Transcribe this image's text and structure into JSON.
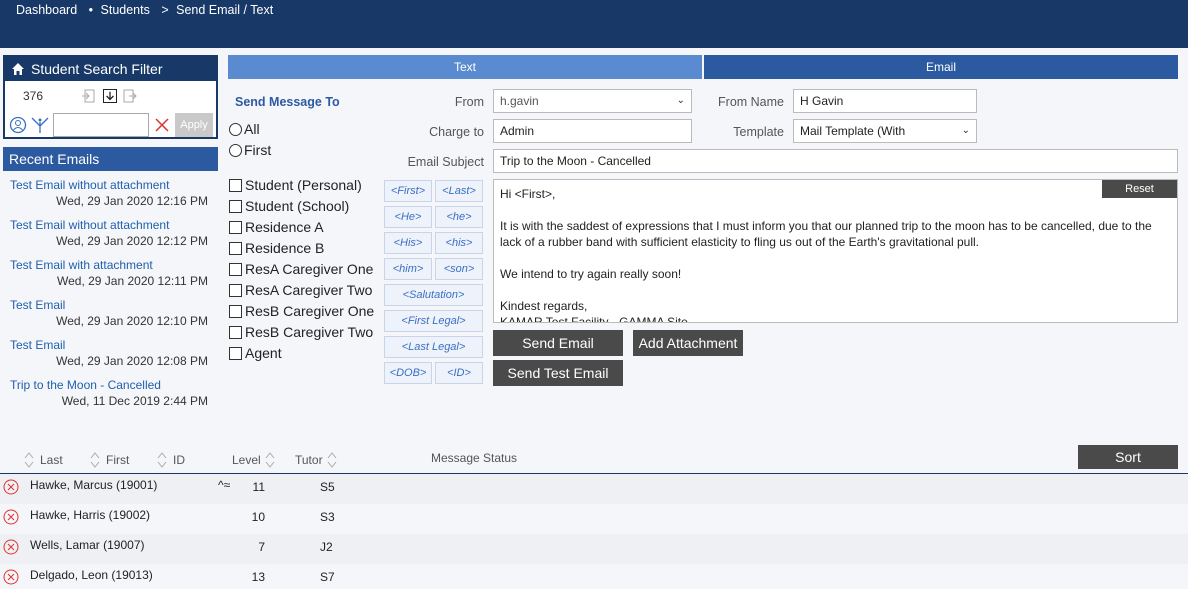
{
  "breadcrumb": {
    "item1": "Dashboard",
    "sep1": "•",
    "item2": "Students",
    "sep2": ">",
    "item3": "Send Email / Text"
  },
  "filter": {
    "title": "Student Search Filter",
    "count": "376",
    "input_value": "",
    "apply_label": "Apply"
  },
  "recent": {
    "title": "Recent Emails",
    "items": [
      {
        "title": "Test Email without attachment",
        "date": "Wed, 29 Jan 2020 12:16 PM"
      },
      {
        "title": "Test Email without attachment",
        "date": "Wed, 29 Jan 2020 12:12 PM"
      },
      {
        "title": "Test Email with attachment",
        "date": "Wed, 29 Jan 2020 12:11 PM"
      },
      {
        "title": "Test Email",
        "date": "Wed, 29 Jan 2020 12:10 PM"
      },
      {
        "title": "Test Email",
        "date": "Wed, 29 Jan 2020 12:08 PM"
      },
      {
        "title": "Trip to the Moon - Cancelled",
        "date": "Wed, 11 Dec 2019 2:44 PM"
      }
    ]
  },
  "tabs": {
    "text": "Text",
    "email": "Email"
  },
  "send_to": {
    "title": "Send Message To",
    "radios": [
      "All",
      "First"
    ],
    "checks": [
      "Student (Personal)",
      "Student (School)",
      "Residence A",
      "Residence B",
      "ResA Caregiver One",
      "ResA Caregiver Two",
      "ResB Caregiver One",
      "ResB Caregiver Two",
      "Agent"
    ]
  },
  "merge": {
    "first": "<First>",
    "last": "<Last>",
    "he_cap": "<He>",
    "he": "<he>",
    "his_cap": "<His>",
    "his": "<his>",
    "him": "<him>",
    "son": "<son>",
    "salutation": "<Salutation>",
    "first_legal": "<First Legal>",
    "last_legal": "<Last Legal>",
    "dob": "<DOB>",
    "id": "<ID>"
  },
  "form": {
    "from_label": "From",
    "from_value": "h.gavin",
    "from_name_label": "From Name",
    "from_name_value": "H Gavin",
    "charge_label": "Charge to",
    "charge_value": "Admin",
    "template_label": "Template",
    "template_value": "Mail Template (With",
    "subject_label": "Email Subject",
    "subject_value": "Trip to the Moon - Cancelled",
    "body_greeting": "Hi <First>,",
    "body_p1": "It is with the saddest of expressions that I must inform you that our planned trip to the moon has to be cancelled, due to the lack of a rubber band with sufficient elasticity to fling us out of the Earth's gravitational pull.",
    "body_p2": "We intend to try again really soon!",
    "body_p3": "Kindest regards,",
    "body_p4": "KAMAR Test Facility - GAMMA Site",
    "reset_label": "Reset",
    "send_email": "Send Email",
    "add_attachment": "Add Attachment",
    "send_test": "Send Test Email"
  },
  "table": {
    "headers": {
      "last": "Last",
      "first": "First",
      "id": "ID",
      "level": "Level",
      "tutor": "Tutor",
      "status": "Message Status"
    },
    "sort_label": "Sort",
    "rows": [
      {
        "name": "Hawke, Marcus (19001)",
        "flag": "^≈",
        "level": "11",
        "tutor": "S5"
      },
      {
        "name": "Hawke, Harris (19002)",
        "flag": "",
        "level": "10",
        "tutor": "S3"
      },
      {
        "name": "Wells, Lamar (19007)",
        "flag": "",
        "level": "7",
        "tutor": "J2"
      },
      {
        "name": "Delgado, Leon (19013)",
        "flag": "",
        "level": "13",
        "tutor": "S7"
      }
    ]
  }
}
